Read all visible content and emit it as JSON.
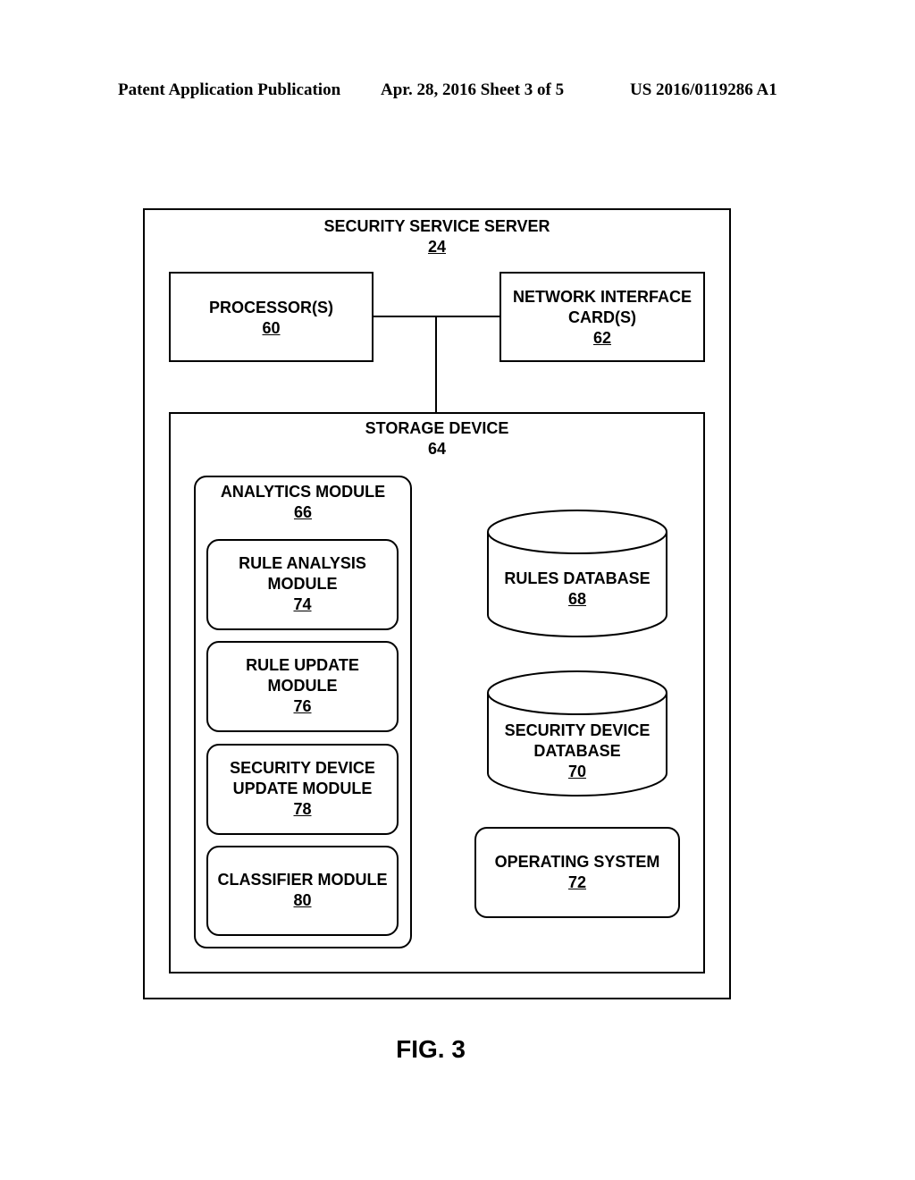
{
  "header": {
    "publication": "Patent Application Publication",
    "date_sheet": "Apr. 28, 2016  Sheet 3 of 5",
    "number": "US 2016/0119286 A1"
  },
  "server": {
    "title": "SECURITY SERVICE SERVER",
    "num": "24"
  },
  "processor": {
    "title": "PROCESSOR(S)",
    "num": "60"
  },
  "nic": {
    "line1": "NETWORK INTERFACE",
    "line2": "CARD(S)",
    "num": "62"
  },
  "storage": {
    "title": "STORAGE DEVICE",
    "num": "64"
  },
  "analytics": {
    "title": "ANALYTICS MODULE",
    "num": "66"
  },
  "rule_analysis": {
    "line1": "RULE ANALYSIS",
    "line2": "MODULE",
    "num": "74"
  },
  "rule_update": {
    "line1": "RULE UPDATE",
    "line2": "MODULE",
    "num": "76"
  },
  "sec_dev_update": {
    "line1": "SECURITY DEVICE",
    "line2": "UPDATE MODULE",
    "num": "78"
  },
  "classifier": {
    "title": "CLASSIFIER MODULE",
    "num": "80"
  },
  "rules_db": {
    "title": "RULES DATABASE",
    "num": "68"
  },
  "sec_dev_db": {
    "line1": "SECURITY DEVICE",
    "line2": "DATABASE",
    "num": "70"
  },
  "os": {
    "title": "OPERATING SYSTEM",
    "num": "72"
  },
  "figure": {
    "caption": "FIG. 3"
  }
}
